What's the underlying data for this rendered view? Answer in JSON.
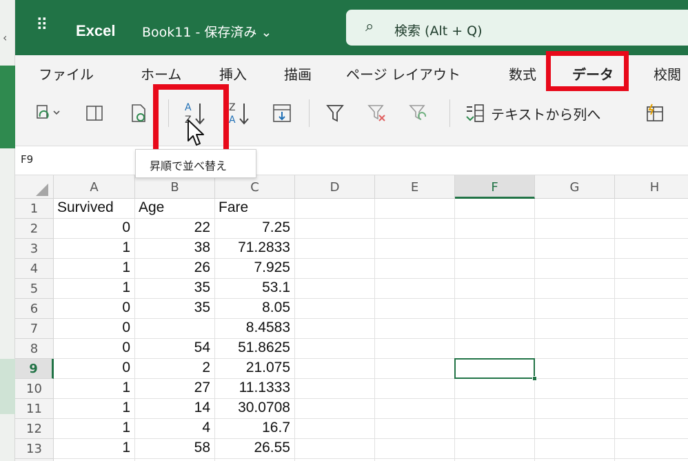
{
  "title_bar": {
    "waffle": "⠿",
    "app_name": "Excel",
    "book_name": "Book11 - 保存済み ⌄",
    "search_placeholder": "検索 (Alt + Q)"
  },
  "ribbon_tabs": [
    "ファイル",
    "ホーム",
    "挿入",
    "描画",
    "ページ レイアウト",
    "数式",
    "データ",
    "校閲"
  ],
  "active_tab": "データ",
  "toolbar": {
    "sort_asc_label": "A↓Z",
    "sort_desc_label": "Z↓A",
    "text_to_columns_label": "テキストから列へ",
    "tooltip": "昇順で並べ替え"
  },
  "formula_bar": {
    "name_box": "F9"
  },
  "columns": [
    "A",
    "B",
    "C",
    "D",
    "E",
    "F",
    "G",
    "H"
  ],
  "selected_column": "F",
  "selected_row": "9",
  "rows": [
    {
      "n": "1",
      "a": "Survived",
      "b": "Age",
      "c": "Fare"
    },
    {
      "n": "2",
      "a": "0",
      "b": "22",
      "c": "7.25"
    },
    {
      "n": "3",
      "a": "1",
      "b": "38",
      "c": "71.2833"
    },
    {
      "n": "4",
      "a": "1",
      "b": "26",
      "c": "7.925"
    },
    {
      "n": "5",
      "a": "1",
      "b": "35",
      "c": "53.1"
    },
    {
      "n": "6",
      "a": "0",
      "b": "35",
      "c": "8.05"
    },
    {
      "n": "7",
      "a": "0",
      "b": "",
      "c": "8.4583"
    },
    {
      "n": "8",
      "a": "0",
      "b": "54",
      "c": "51.8625"
    },
    {
      "n": "9",
      "a": "0",
      "b": "2",
      "c": "21.075"
    },
    {
      "n": "10",
      "a": "1",
      "b": "27",
      "c": "11.1333"
    },
    {
      "n": "11",
      "a": "1",
      "b": "14",
      "c": "30.0708"
    },
    {
      "n": "12",
      "a": "1",
      "b": "4",
      "c": "16.7"
    },
    {
      "n": "13",
      "a": "1",
      "b": "58",
      "c": "26.55"
    }
  ],
  "colors": {
    "excel_green": "#217346",
    "highlight_red": "#e8091a"
  }
}
